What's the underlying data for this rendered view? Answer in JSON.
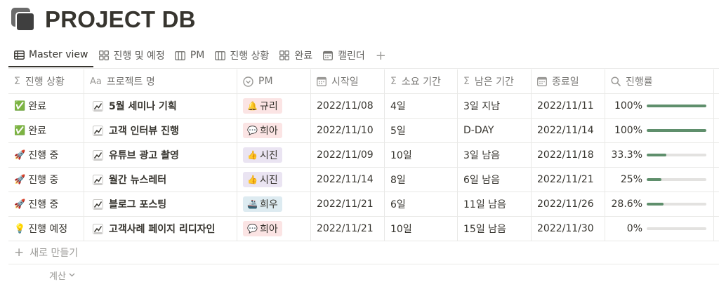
{
  "page": {
    "title": "PROJECT DB",
    "icon": "database-icon"
  },
  "tabs": [
    {
      "label": "Master view",
      "icon": "table-icon",
      "active": true
    },
    {
      "label": "진행 및 예정",
      "icon": "gallery-icon",
      "active": false
    },
    {
      "label": "PM",
      "icon": "board-icon",
      "active": false
    },
    {
      "label": "진행 상황",
      "icon": "board-icon",
      "active": false
    },
    {
      "label": "완료",
      "icon": "gallery-icon",
      "active": false
    },
    {
      "label": "캘린더",
      "icon": "calendar-icon",
      "active": false
    }
  ],
  "tab_add": "+",
  "columns": [
    {
      "label": "진행 상황",
      "icon": "Σ"
    },
    {
      "label": "프로젝트 명",
      "icon": "Aa"
    },
    {
      "label": "PM",
      "icon": "◉"
    },
    {
      "label": "시작일",
      "icon": "calendar"
    },
    {
      "label": "소요 기간",
      "icon": "Σ"
    },
    {
      "label": "남은 기간",
      "icon": "Σ"
    },
    {
      "label": "종료일",
      "icon": "calendar"
    },
    {
      "label": "진행률",
      "icon": "search"
    }
  ],
  "rows": [
    {
      "status_emoji": "✅",
      "status": "완료",
      "name": "5월 세미나 기획",
      "pm": "규리",
      "pm_emoji": "🔔",
      "pm_color": "#fbe4e4",
      "start": "2022/11/08",
      "duration": "4일",
      "remaining": "3일 지남",
      "end": "2022/11/11",
      "progress_label": "100%",
      "progress": 1.0
    },
    {
      "status_emoji": "✅",
      "status": "완료",
      "name": "고객 인터뷰 진행",
      "pm": "희아",
      "pm_emoji": "💬",
      "pm_color": "#fbe4e4",
      "start": "2022/11/10",
      "duration": "5일",
      "remaining": "D-DAY",
      "end": "2022/11/14",
      "progress_label": "100%",
      "progress": 1.0
    },
    {
      "status_emoji": "🚀",
      "status": "진행 중",
      "name": "유튜브 광고 촬영",
      "pm": "시진",
      "pm_emoji": "👍",
      "pm_color": "#eae4f2",
      "start": "2022/11/09",
      "duration": "10일",
      "remaining": "3일 남음",
      "end": "2022/11/18",
      "progress_label": "33.3%",
      "progress": 0.333
    },
    {
      "status_emoji": "🚀",
      "status": "진행 중",
      "name": "월간 뉴스레터",
      "pm": "시진",
      "pm_emoji": "👍",
      "pm_color": "#eae4f2",
      "start": "2022/11/14",
      "duration": "8일",
      "remaining": "6일 남음",
      "end": "2022/11/21",
      "progress_label": "25%",
      "progress": 0.25
    },
    {
      "status_emoji": "🚀",
      "status": "진행 중",
      "name": "블로그 포스팅",
      "pm": "희우",
      "pm_emoji": "🚢",
      "pm_color": "#ddebf1",
      "start": "2022/11/21",
      "duration": "6일",
      "remaining": "11일 남음",
      "end": "2022/11/26",
      "progress_label": "28.6%",
      "progress": 0.286
    },
    {
      "status_emoji": "💡",
      "status": "진행 예정",
      "name": "고객사례 페이지 리디자인",
      "pm": "희아",
      "pm_emoji": "💬",
      "pm_color": "#fbe4e4",
      "start": "2022/11/21",
      "duration": "10일",
      "remaining": "15일 남음",
      "end": "2022/11/30",
      "progress_label": "0%",
      "progress": 0
    }
  ],
  "new_row_label": "새로 만들기",
  "calc_label": "계산",
  "colors": {
    "progress_fill": "#5f8f6c",
    "progress_track": "#e3e2e0",
    "text": "#37352f",
    "muted": "#9b9a97",
    "border": "#e9e9e7"
  }
}
